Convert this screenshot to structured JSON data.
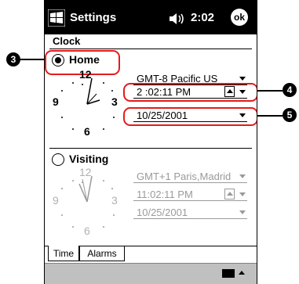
{
  "titlebar": {
    "title": "Settings",
    "time": "2:02",
    "ok": "ok"
  },
  "heading": "Clock",
  "home": {
    "label": "Home",
    "selected": true,
    "timezone": "GMT-8 Pacific US",
    "time": "2 :02:11 PM",
    "date": "10/25/2001",
    "clock_digits": {
      "twelve": "12",
      "three": "3",
      "six": "6",
      "nine": "9"
    }
  },
  "visiting": {
    "label": "Visiting",
    "selected": false,
    "timezone": "GMT+1 Paris,Madrid",
    "time": "11:02:11 PM",
    "date": "10/25/2001",
    "clock_digits": {
      "twelve": "12",
      "three": "3",
      "six": "6",
      "nine": "9"
    }
  },
  "tabs": [
    {
      "label": "Time"
    },
    {
      "label": "Alarms"
    }
  ],
  "callouts": {
    "home": "3",
    "time": "4",
    "date": "5"
  },
  "colors": {
    "titlebar": "#000000",
    "highlight": "#e41b1b",
    "dimmed": "#9a9a9a",
    "bottombar": "#c0c0c0"
  },
  "icons": [
    "windows-start-icon",
    "speaker-icon",
    "ok-button",
    "keyboard-icon",
    "up-arrow-icon"
  ]
}
